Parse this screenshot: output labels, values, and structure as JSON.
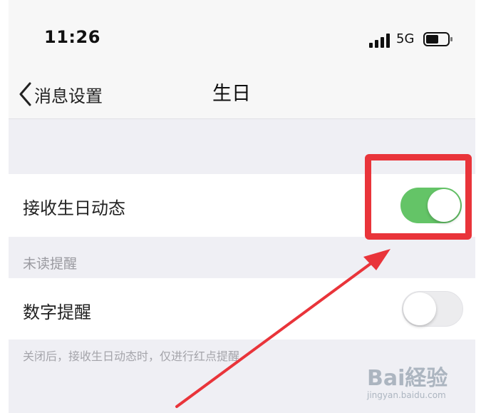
{
  "status_bar": {
    "time": "11:26",
    "network": "5G",
    "icons": [
      "signal-icon",
      "battery-icon"
    ]
  },
  "nav": {
    "back_label": "消息设置",
    "title": "生日",
    "back_icon": "chevron-left-icon"
  },
  "settings": {
    "birthday_feed": {
      "label": "接收生日动态",
      "on": true
    },
    "unread_section_header": "未读提醒",
    "number_reminder": {
      "label": "数字提醒",
      "on": false
    },
    "footer_note": "关闭后，接收生日动态时，仅进行红点提醒"
  },
  "colors": {
    "toggle_on": "#64c467",
    "highlight": "#e9343a",
    "background": "#efeff4"
  },
  "watermark": {
    "brand": "Bai経验",
    "url": "jingyan.baidu.com"
  }
}
